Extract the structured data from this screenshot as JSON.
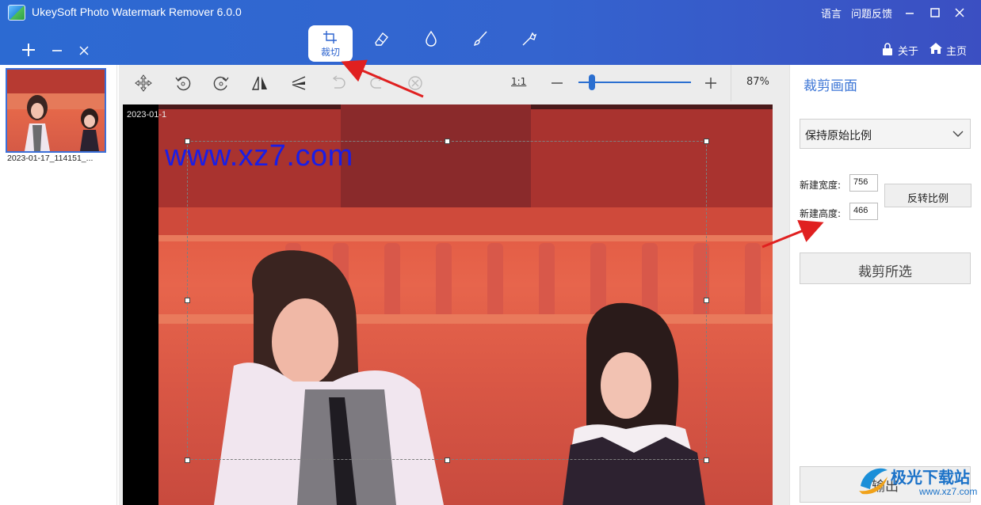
{
  "app": {
    "title": "UkeySoft Photo Watermark Remover 6.0.0",
    "language_label": "语言",
    "feedback_label": "问题反馈",
    "about_label": "关于",
    "home_label": "主页"
  },
  "tools": {
    "crop_label": "裁切",
    "active": "crop"
  },
  "file_list": {
    "items": [
      {
        "name": "2023-01-17_114151_..."
      }
    ]
  },
  "toolbar": {
    "fit_label": "1:1",
    "zoom": "87%"
  },
  "canvas": {
    "timestamp_overlay": "2023-01-1",
    "watermark_text": "www.xz7.com"
  },
  "crop_panel": {
    "title": "裁剪画面",
    "ratio_select": "保持原始比例",
    "width_label": "新建宽度:",
    "width_value": "756",
    "height_label": "新建高度:",
    "height_value": "466",
    "flip_ratio_label": "反转比例",
    "crop_selected_label": "裁剪所选",
    "export_label": "输出"
  },
  "site_badge": {
    "name": "极光下载站",
    "url": "www.xz7.com"
  },
  "colors": {
    "titlebar": "#2c6ad2",
    "accent": "#2b6fd0",
    "annotation_arrow": "#e02020"
  }
}
